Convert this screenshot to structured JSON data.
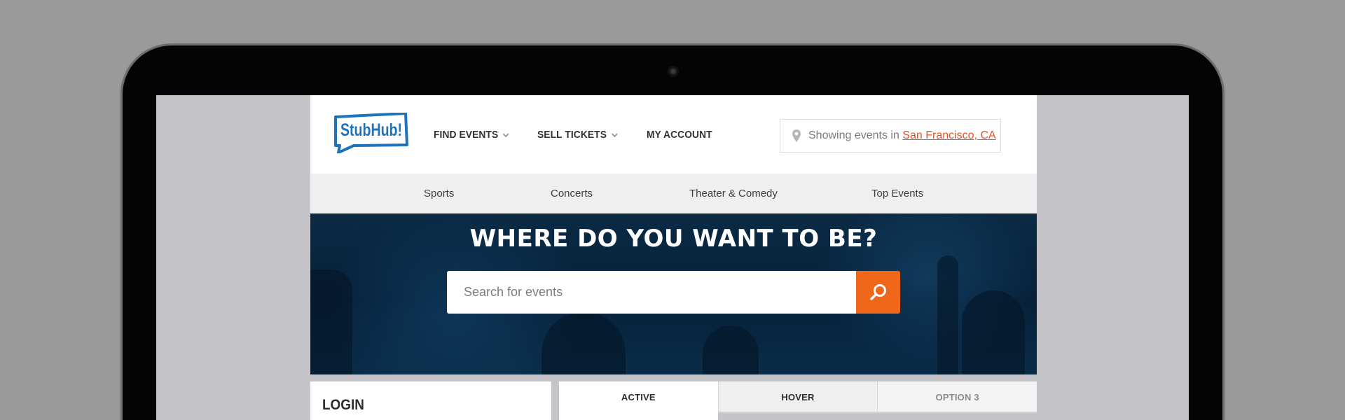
{
  "brand": {
    "logo_text": "StubHub!",
    "primary_color": "#1e73be",
    "accent_color": "#f0661a",
    "hero_color": "#07213a"
  },
  "header": {
    "nav": [
      {
        "label": "FIND EVENTS",
        "has_dropdown": true
      },
      {
        "label": "SELL TICKETS",
        "has_dropdown": true
      },
      {
        "label": "MY ACCOUNT",
        "has_dropdown": false
      }
    ],
    "location": {
      "prefix": "Showing events in",
      "city": "San Francisco, CA",
      "icon": "location-pin-icon"
    }
  },
  "categories": [
    "Sports",
    "Concerts",
    "Theater & Comedy",
    "Top Events"
  ],
  "hero": {
    "title": "WHERE DO YOU WANT TO BE?",
    "search_placeholder": "Search for events",
    "search_icon": "search-icon"
  },
  "login": {
    "title": "LOGIN"
  },
  "tabs": [
    {
      "label": "ACTIVE",
      "state": "active"
    },
    {
      "label": "HOVER",
      "state": "hover"
    },
    {
      "label": "OPTION 3",
      "state": "default"
    }
  ]
}
